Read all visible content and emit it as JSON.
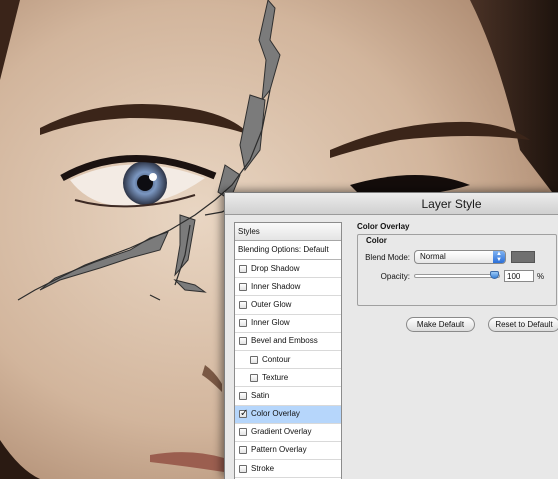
{
  "dialog": {
    "title": "Layer Style"
  },
  "styles_panel": {
    "header": "Styles",
    "blending": "Blending Options: Default",
    "items": [
      {
        "label": "Drop Shadow",
        "checked": false,
        "sub": false,
        "selected": false
      },
      {
        "label": "Inner Shadow",
        "checked": false,
        "sub": false,
        "selected": false
      },
      {
        "label": "Outer Glow",
        "checked": false,
        "sub": false,
        "selected": false
      },
      {
        "label": "Inner Glow",
        "checked": false,
        "sub": false,
        "selected": false
      },
      {
        "label": "Bevel and Emboss",
        "checked": false,
        "sub": false,
        "selected": false
      },
      {
        "label": "Contour",
        "checked": false,
        "sub": true,
        "selected": false
      },
      {
        "label": "Texture",
        "checked": false,
        "sub": true,
        "selected": false
      },
      {
        "label": "Satin",
        "checked": false,
        "sub": false,
        "selected": false
      },
      {
        "label": "Color Overlay",
        "checked": true,
        "sub": false,
        "selected": true
      },
      {
        "label": "Gradient Overlay",
        "checked": false,
        "sub": false,
        "selected": false
      },
      {
        "label": "Pattern Overlay",
        "checked": false,
        "sub": false,
        "selected": false
      },
      {
        "label": "Stroke",
        "checked": false,
        "sub": false,
        "selected": false
      }
    ]
  },
  "color_overlay": {
    "section_title": "Color Overlay",
    "group_title": "Color",
    "blend_mode_label": "Blend Mode:",
    "blend_mode_value": "Normal",
    "overlay_color": "#707070",
    "opacity_label": "Opacity:",
    "opacity_value": "100",
    "opacity_unit": "%",
    "opacity_fraction": 1.0,
    "make_default": "Make Default",
    "reset_default": "Reset to Default"
  }
}
